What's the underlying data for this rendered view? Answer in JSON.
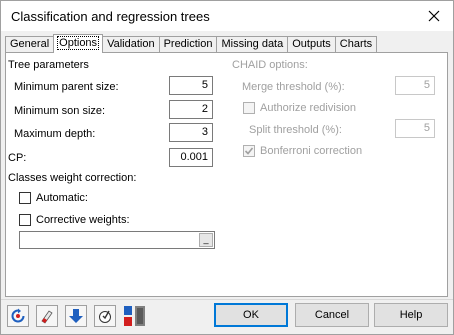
{
  "window": {
    "title": "Classification and regression trees"
  },
  "tabs": [
    {
      "label": "General"
    },
    {
      "label": "Options"
    },
    {
      "label": "Validation"
    },
    {
      "label": "Prediction"
    },
    {
      "label": "Missing data"
    },
    {
      "label": "Outputs"
    },
    {
      "label": "Charts"
    }
  ],
  "tree_params": {
    "heading": "Tree parameters",
    "min_parent_label": "Minimum parent size:",
    "min_parent_value": "5",
    "min_son_label": "Minimum son size:",
    "min_son_value": "2",
    "max_depth_label": "Maximum depth:",
    "max_depth_value": "3",
    "cp_label": "CP:",
    "cp_value": "0.001"
  },
  "weights": {
    "heading": "Classes weight correction:",
    "automatic_label": "Automatic:",
    "corrective_label": "Corrective weights:",
    "corrective_value": ""
  },
  "chaid": {
    "heading": "CHAID options:",
    "merge_label": "Merge threshold (%):",
    "merge_value": "5",
    "redivision_label": "Authorize redivision",
    "split_label": "Split threshold (%):",
    "split_value": "5",
    "bonferroni_label": "Bonferroni correction"
  },
  "buttons": {
    "ok": "OK",
    "cancel": "Cancel",
    "help": "Help"
  },
  "icons": {
    "reset": "reset-icon",
    "clear": "eraser-icon",
    "download": "arrow-down-icon",
    "hand": "hand-icon",
    "colors": "color-swap-icon",
    "close": "close-icon"
  },
  "colors": {
    "accent": "#0078d7",
    "disabled_text": "#a0a0a0",
    "icon_blue": "#1e5fbf",
    "icon_red": "#d21e1e"
  }
}
